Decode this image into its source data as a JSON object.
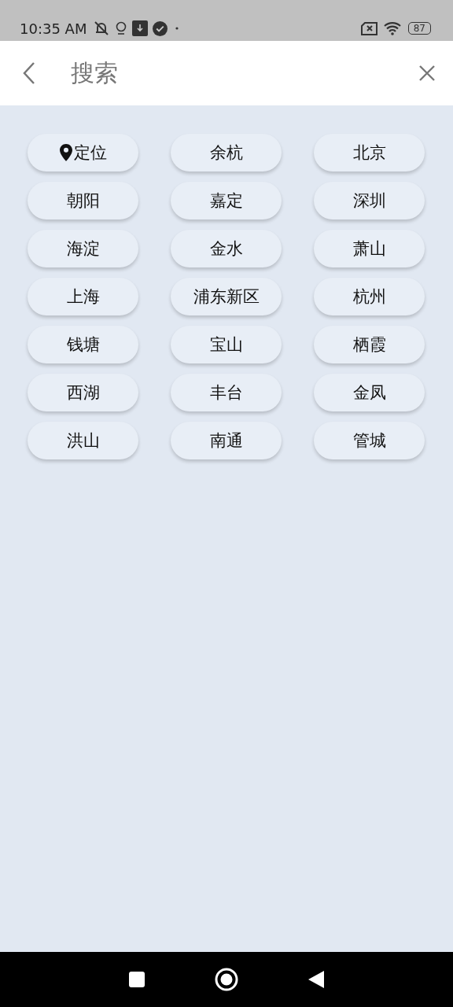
{
  "status_bar": {
    "time": "10:35 AM",
    "battery": "87"
  },
  "header": {
    "title": "搜索"
  },
  "chips": [
    {
      "label": "定位",
      "kind": "location"
    },
    {
      "label": "余杭",
      "kind": "city"
    },
    {
      "label": "北京",
      "kind": "city"
    },
    {
      "label": "朝阳",
      "kind": "city"
    },
    {
      "label": "嘉定",
      "kind": "city"
    },
    {
      "label": "深圳",
      "kind": "city"
    },
    {
      "label": "海淀",
      "kind": "city"
    },
    {
      "label": "金水",
      "kind": "city"
    },
    {
      "label": "萧山",
      "kind": "city"
    },
    {
      "label": "上海",
      "kind": "city"
    },
    {
      "label": "浦东新区",
      "kind": "city"
    },
    {
      "label": "杭州",
      "kind": "city"
    },
    {
      "label": "钱塘",
      "kind": "city"
    },
    {
      "label": "宝山",
      "kind": "city"
    },
    {
      "label": "栖霞",
      "kind": "city"
    },
    {
      "label": "西湖",
      "kind": "city"
    },
    {
      "label": "丰台",
      "kind": "city"
    },
    {
      "label": "金凤",
      "kind": "city"
    },
    {
      "label": "洪山",
      "kind": "city"
    },
    {
      "label": "南通",
      "kind": "city"
    },
    {
      "label": "管城",
      "kind": "city"
    }
  ]
}
